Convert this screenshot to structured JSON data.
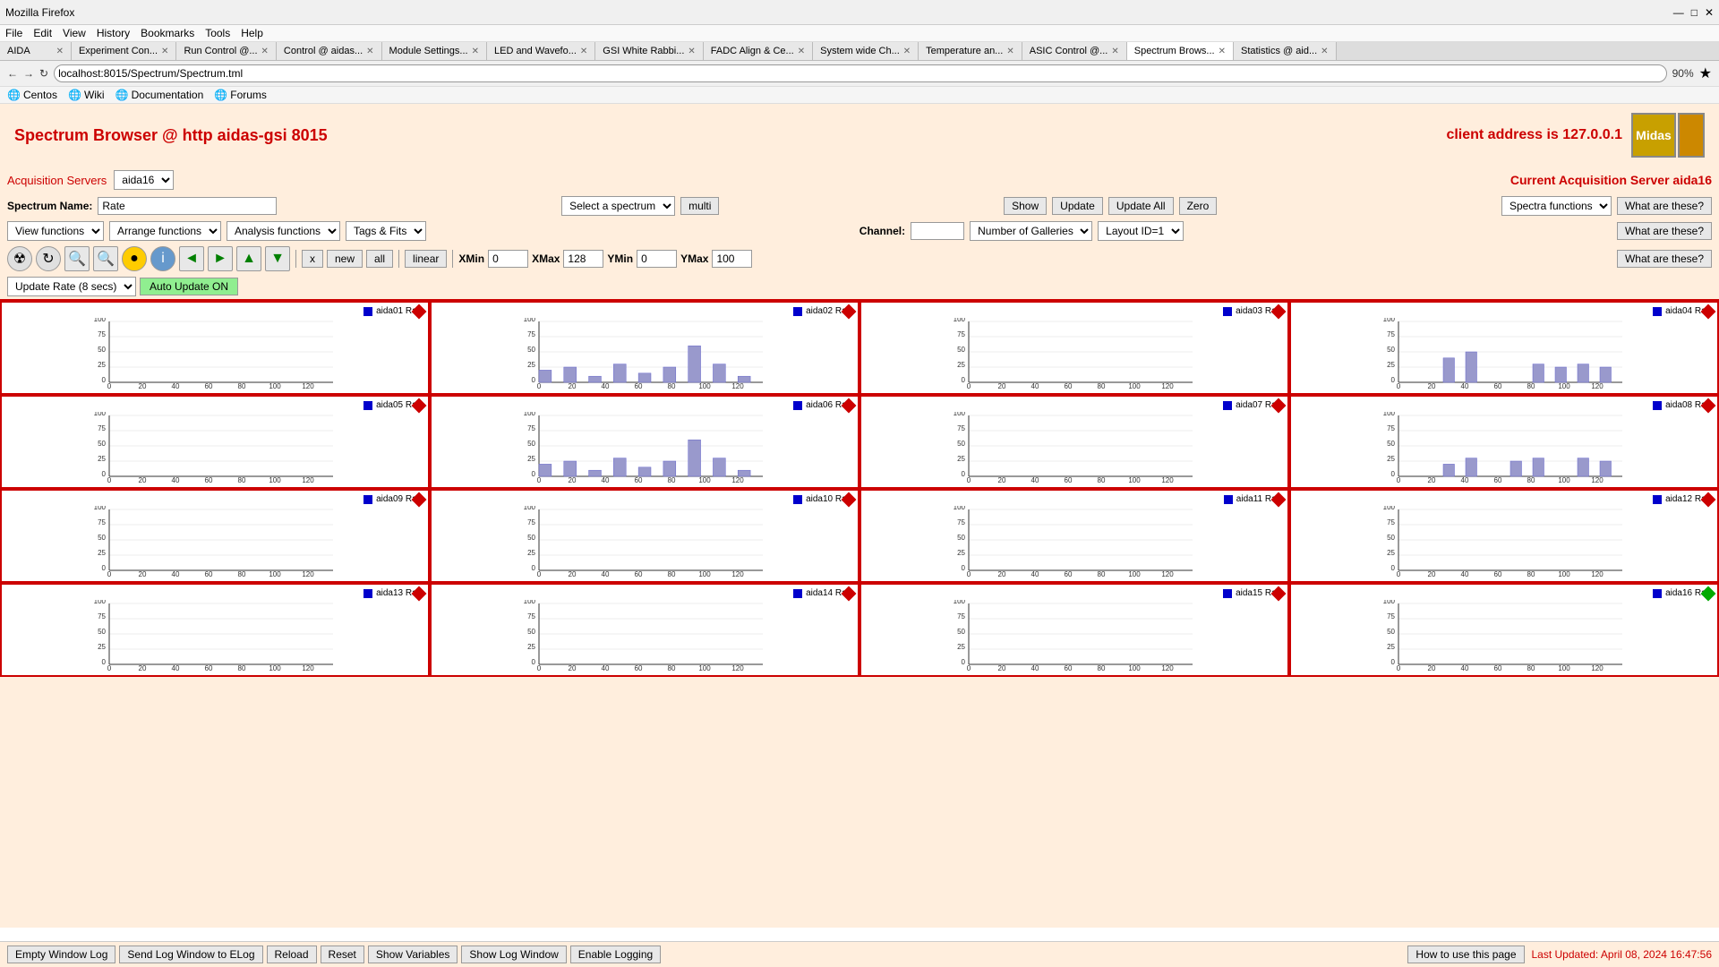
{
  "browser": {
    "menu_items": [
      "File",
      "Edit",
      "View",
      "History",
      "Bookmarks",
      "Tools",
      "Help"
    ],
    "tabs": [
      {
        "label": "AIDA",
        "active": false
      },
      {
        "label": "Experiment Con...",
        "active": false
      },
      {
        "label": "Run Control @...",
        "active": false
      },
      {
        "label": "Control @ aidas...",
        "active": false
      },
      {
        "label": "Module Settings...",
        "active": false
      },
      {
        "label": "LED and Wavefo...",
        "active": false
      },
      {
        "label": "GSI White Rabbi...",
        "active": false
      },
      {
        "label": "FADC Align & Ce...",
        "active": false
      },
      {
        "label": "System wide Ch...",
        "active": false
      },
      {
        "label": "Temperature an...",
        "active": false
      },
      {
        "label": "ASIC Control @...",
        "active": false
      },
      {
        "label": "Spectrum Brows...",
        "active": true
      },
      {
        "label": "Statistics @ aid...",
        "active": false
      }
    ],
    "address": "localhost:8015/Spectrum/Spectrum.tml",
    "zoom": "90%",
    "bookmarks": [
      "Centos",
      "Wiki",
      "Documentation",
      "Forums"
    ]
  },
  "page": {
    "title_left": "Spectrum Browser @ http aidas-gsi 8015",
    "title_right": "client address is 127.0.0.1",
    "acq_servers_label": "Acquisition Servers",
    "acq_server_value": "aida16",
    "current_server_label": "Current Acquisition Server aida16",
    "spectrum_name_label": "Spectrum Name:",
    "spectrum_name_value": "Rate",
    "select_spectrum_label": "Select a spectrum",
    "multi_label": "multi",
    "show_label": "Show",
    "update_label": "Update",
    "update_all_label": "Update All",
    "zero_label": "Zero",
    "spectra_functions_label": "Spectra functions",
    "what_are_these_label": "What are these?",
    "view_functions_label": "View functions",
    "arrange_functions_label": "Arrange functions",
    "analysis_functions_label": "Analysis functions",
    "tags_fits_label": "Tags & Fits",
    "channel_label": "Channel:",
    "number_of_galleries_label": "Number of Galleries",
    "layout_id_label": "Layout ID=1",
    "x_label": "x",
    "new_label": "new",
    "all_label": "all",
    "linear_label": "linear",
    "xmin_label": "XMin",
    "xmin_value": "0",
    "xmax_label": "XMax",
    "xmax_value": "128",
    "ymin_label": "YMin",
    "ymin_value": "0",
    "ymax_label": "YMax",
    "ymax_value": "100",
    "update_rate_label": "Update Rate (8 secs)",
    "auto_update_label": "Auto Update ON",
    "charts": [
      {
        "id": "aida01",
        "label": "aida01 Rate",
        "marker": "red",
        "has_data": false,
        "bars": []
      },
      {
        "id": "aida02",
        "label": "aida02 Rate",
        "marker": "red",
        "has_data": true,
        "bars": [
          20,
          25,
          10,
          30,
          15,
          25,
          60,
          30,
          10
        ]
      },
      {
        "id": "aida03",
        "label": "aida03 Rate",
        "marker": "red",
        "has_data": false,
        "bars": []
      },
      {
        "id": "aida04",
        "label": "aida04 Rate",
        "marker": "red",
        "has_data": true,
        "bars": [
          0,
          0,
          40,
          50,
          0,
          0,
          30,
          25,
          30,
          25
        ]
      },
      {
        "id": "aida05",
        "label": "aida05 Rate",
        "marker": "red",
        "has_data": false,
        "bars": []
      },
      {
        "id": "aida06",
        "label": "aida06 Rate",
        "marker": "red",
        "has_data": true,
        "bars": [
          20,
          25,
          10,
          30,
          15,
          25,
          60,
          30,
          10
        ]
      },
      {
        "id": "aida07",
        "label": "aida07 Rate",
        "marker": "red",
        "has_data": false,
        "bars": []
      },
      {
        "id": "aida08",
        "label": "aida08 Rate",
        "marker": "red",
        "has_data": true,
        "bars": [
          0,
          0,
          20,
          30,
          0,
          25,
          30,
          0,
          30,
          25
        ]
      },
      {
        "id": "aida09",
        "label": "aida09 Rate",
        "marker": "red",
        "has_data": false,
        "bars": []
      },
      {
        "id": "aida10",
        "label": "aida10 Rate",
        "marker": "red",
        "has_data": false,
        "bars": []
      },
      {
        "id": "aida11",
        "label": "aida11 Rate",
        "marker": "red",
        "has_data": false,
        "bars": []
      },
      {
        "id": "aida12",
        "label": "aida12 Rate",
        "marker": "red",
        "has_data": false,
        "bars": []
      },
      {
        "id": "aida13",
        "label": "aida13 Rate",
        "marker": "red",
        "has_data": false,
        "bars": []
      },
      {
        "id": "aida14",
        "label": "aida14 Rate",
        "marker": "red",
        "has_data": false,
        "bars": []
      },
      {
        "id": "aida15",
        "label": "aida15 Rate",
        "marker": "red",
        "has_data": false,
        "bars": []
      },
      {
        "id": "aida16",
        "label": "aida16 Rate",
        "marker": "green",
        "has_data": false,
        "bars": []
      }
    ],
    "status_buttons": [
      {
        "label": "Empty Window Log"
      },
      {
        "label": "Send Log Window to ELog"
      },
      {
        "label": "Reload"
      },
      {
        "label": "Reset"
      },
      {
        "label": "Show Variables"
      },
      {
        "label": "Show Log Window"
      },
      {
        "label": "Enable Logging"
      }
    ],
    "how_to_label": "How to use this page",
    "last_updated": "Last Updated: April 08, 2024 16:47:56"
  }
}
